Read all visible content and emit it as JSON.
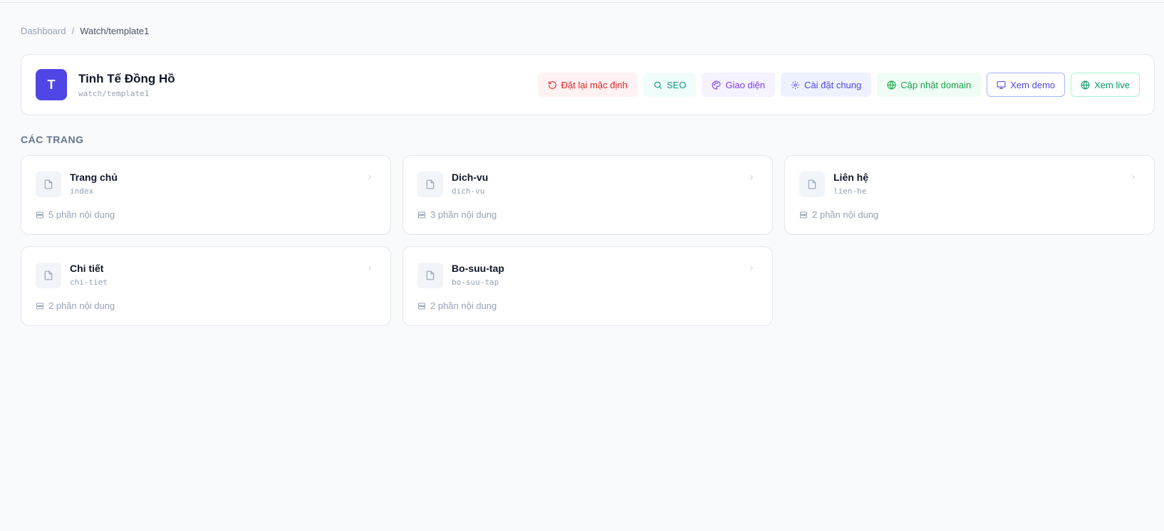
{
  "breadcrumb": {
    "root": "Dashboard",
    "separator": "/",
    "current": "Watch/template1"
  },
  "site": {
    "avatar_letter": "T",
    "name": "Tinh Tế Đồng Hồ",
    "slug": "watch/template1"
  },
  "actions": {
    "reset": "Đặt lại mặc định",
    "seo": "SEO",
    "theme": "Giao diện",
    "settings": "Cài đặt chung",
    "domain": "Cập nhật domain",
    "demo": "Xem demo",
    "live": "Xem live"
  },
  "section_title": "CÁC TRANG",
  "pages": [
    {
      "title": "Trang chủ",
      "slug": "index",
      "sections": "5 phần nội dung"
    },
    {
      "title": "Dich-vu",
      "slug": "dich-vu",
      "sections": "3 phần nội dung"
    },
    {
      "title": "Liên hệ",
      "slug": "lien-he",
      "sections": "2 phần nội dung"
    },
    {
      "title": "Chi tiết",
      "slug": "chi-tiet",
      "sections": "2 phần nội dung"
    },
    {
      "title": "Bo-suu-tap",
      "slug": "bo-suu-tap",
      "sections": "2 phần nội dung"
    }
  ],
  "colors": {
    "brand": "#4f46e5",
    "background": "#f8fafc"
  },
  "icons": {
    "reset": "rotate-ccw-icon",
    "seo": "search-icon",
    "theme": "palette-icon",
    "settings": "gear-icon",
    "domain": "globe-icon",
    "demo": "monitor-icon",
    "live": "globe-icon",
    "page": "file-icon",
    "sections": "stack-icon",
    "open": "chevron-right-icon"
  }
}
